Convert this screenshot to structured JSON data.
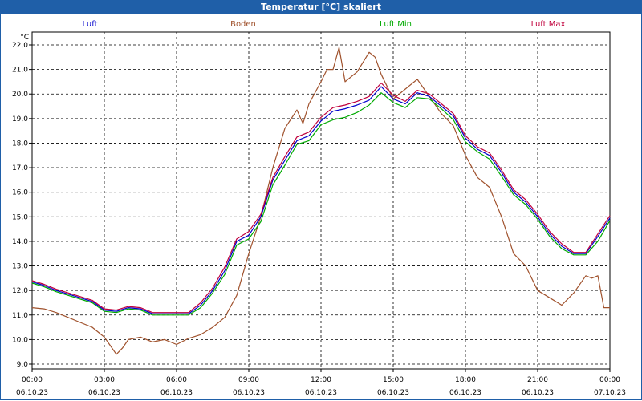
{
  "window": {
    "title": "Temperatur [°C] skaliert"
  },
  "chart_data": {
    "type": "line",
    "title": "Temperatur [°C] skaliert",
    "ylabel": "°C",
    "ylim": [
      9.0,
      22.3
    ],
    "yticks": [
      "9,0",
      "10,0",
      "11,0",
      "12,0",
      "13,0",
      "14,0",
      "15,0",
      "16,0",
      "17,0",
      "18,0",
      "19,0",
      "20,0",
      "21,0",
      "22,0"
    ],
    "xlim": [
      0,
      24
    ],
    "xticks": [
      {
        "time": "00:00",
        "date": "06.10.23"
      },
      {
        "time": "03:00",
        "date": "06.10.23"
      },
      {
        "time": "06:00",
        "date": "06.10.23"
      },
      {
        "time": "09:00",
        "date": "06.10.23"
      },
      {
        "time": "12:00",
        "date": "06.10.23"
      },
      {
        "time": "15:00",
        "date": "06.10.23"
      },
      {
        "time": "18:00",
        "date": "06.10.23"
      },
      {
        "time": "21:00",
        "date": "06.10.23"
      },
      {
        "time": "00:00",
        "date": "07.10.23"
      }
    ],
    "grid": true,
    "legend_position": "top",
    "series": [
      {
        "name": "Luft",
        "color": "#0000cc",
        "x": [
          0,
          0.5,
          1,
          1.5,
          2,
          2.5,
          3,
          3.5,
          4,
          4.5,
          5,
          5.5,
          6,
          6.5,
          7,
          7.5,
          8,
          8.5,
          9,
          9.5,
          10,
          10.5,
          11,
          11.5,
          12,
          12.5,
          13,
          13.5,
          14,
          14.5,
          15,
          15.5,
          16,
          16.5,
          17,
          17.5,
          18,
          18.5,
          19,
          19.5,
          20,
          20.5,
          21,
          21.5,
          22,
          22.5,
          23,
          23.5,
          24
        ],
        "values": [
          12.35,
          12.2,
          12.0,
          11.85,
          11.7,
          11.55,
          11.2,
          11.15,
          11.3,
          11.25,
          11.05,
          11.05,
          11.05,
          11.05,
          11.4,
          12.0,
          12.8,
          14.0,
          14.25,
          15.0,
          16.5,
          17.3,
          18.1,
          18.3,
          18.9,
          19.3,
          19.4,
          19.55,
          19.75,
          20.3,
          19.8,
          19.6,
          20.05,
          19.9,
          19.5,
          19.1,
          18.2,
          17.75,
          17.5,
          16.8,
          16.0,
          15.6,
          15.0,
          14.3,
          13.8,
          13.5,
          13.5,
          14.2,
          14.95
        ]
      },
      {
        "name": "Boden",
        "color": "#a0522d",
        "x": [
          0,
          0.5,
          1,
          1.5,
          2,
          2.5,
          3,
          3.25,
          3.5,
          3.75,
          4,
          4.5,
          5,
          5.5,
          6,
          6.5,
          7,
          7.5,
          8,
          8.5,
          9,
          9.5,
          10,
          10.5,
          11,
          11.25,
          11.5,
          12,
          12.25,
          12.5,
          12.75,
          13,
          13.5,
          14,
          14.25,
          14.5,
          15,
          15.5,
          16,
          16.5,
          17,
          17.5,
          18,
          18.5,
          19,
          19.5,
          20,
          20.5,
          21,
          21.5,
          22,
          22.5,
          23,
          23.25,
          23.5,
          23.75,
          24
        ],
        "values": [
          11.3,
          11.25,
          11.1,
          10.9,
          10.7,
          10.5,
          10.1,
          9.75,
          9.4,
          9.65,
          10.0,
          10.1,
          9.9,
          10.0,
          9.8,
          10.05,
          10.2,
          10.5,
          10.9,
          11.8,
          13.5,
          15.0,
          17.0,
          18.6,
          19.35,
          18.8,
          19.6,
          20.5,
          21.0,
          21.0,
          21.9,
          20.5,
          20.9,
          21.7,
          21.5,
          20.8,
          19.8,
          20.2,
          20.6,
          19.9,
          19.2,
          18.7,
          17.5,
          16.6,
          16.2,
          15.0,
          13.5,
          13.0,
          12.0,
          11.7,
          11.4,
          11.9,
          12.6,
          12.5,
          12.6,
          11.3,
          11.3
        ]
      },
      {
        "name": "Luft Min",
        "color": "#00aa00",
        "x": [
          0,
          0.5,
          1,
          1.5,
          2,
          2.5,
          3,
          3.5,
          4,
          4.5,
          5,
          5.5,
          6,
          6.5,
          7,
          7.5,
          8,
          8.5,
          9,
          9.5,
          10,
          10.5,
          11,
          11.5,
          12,
          12.5,
          13,
          13.5,
          14,
          14.5,
          15,
          15.5,
          16,
          16.5,
          17,
          17.5,
          18,
          18.5,
          19,
          19.5,
          20,
          20.5,
          21,
          21.5,
          22,
          22.5,
          23,
          23.5,
          24
        ],
        "values": [
          12.3,
          12.15,
          11.95,
          11.8,
          11.65,
          11.5,
          11.15,
          11.1,
          11.25,
          11.2,
          11.0,
          11.0,
          11.0,
          11.0,
          11.3,
          11.9,
          12.65,
          13.85,
          14.1,
          14.8,
          16.3,
          17.1,
          17.95,
          18.1,
          18.75,
          18.95,
          19.05,
          19.25,
          19.55,
          20.05,
          19.65,
          19.45,
          19.85,
          19.8,
          19.4,
          18.95,
          18.05,
          17.65,
          17.35,
          16.65,
          15.9,
          15.5,
          14.9,
          14.2,
          13.7,
          13.45,
          13.45,
          14.0,
          14.85
        ]
      },
      {
        "name": "Luft Max",
        "color": "#c0003c",
        "x": [
          0,
          0.5,
          1,
          1.5,
          2,
          2.5,
          3,
          3.5,
          4,
          4.5,
          5,
          5.5,
          6,
          6.5,
          7,
          7.5,
          8,
          8.5,
          9,
          9.5,
          10,
          10.5,
          11,
          11.5,
          12,
          12.5,
          13,
          13.5,
          14,
          14.5,
          15,
          15.5,
          16,
          16.5,
          17,
          17.5,
          18,
          18.5,
          19,
          19.5,
          20,
          20.5,
          21,
          21.5,
          22,
          22.5,
          23,
          23.5,
          24
        ],
        "values": [
          12.4,
          12.25,
          12.05,
          11.9,
          11.75,
          11.6,
          11.25,
          11.2,
          11.35,
          11.3,
          11.1,
          11.1,
          11.1,
          11.1,
          11.5,
          12.1,
          12.95,
          14.1,
          14.4,
          15.1,
          16.6,
          17.45,
          18.25,
          18.45,
          19.05,
          19.45,
          19.55,
          19.7,
          19.9,
          20.45,
          19.95,
          19.7,
          20.15,
          20.0,
          19.6,
          19.2,
          18.3,
          17.85,
          17.6,
          16.9,
          16.1,
          15.7,
          15.1,
          14.4,
          13.9,
          13.55,
          13.55,
          14.3,
          15.05
        ]
      }
    ]
  }
}
